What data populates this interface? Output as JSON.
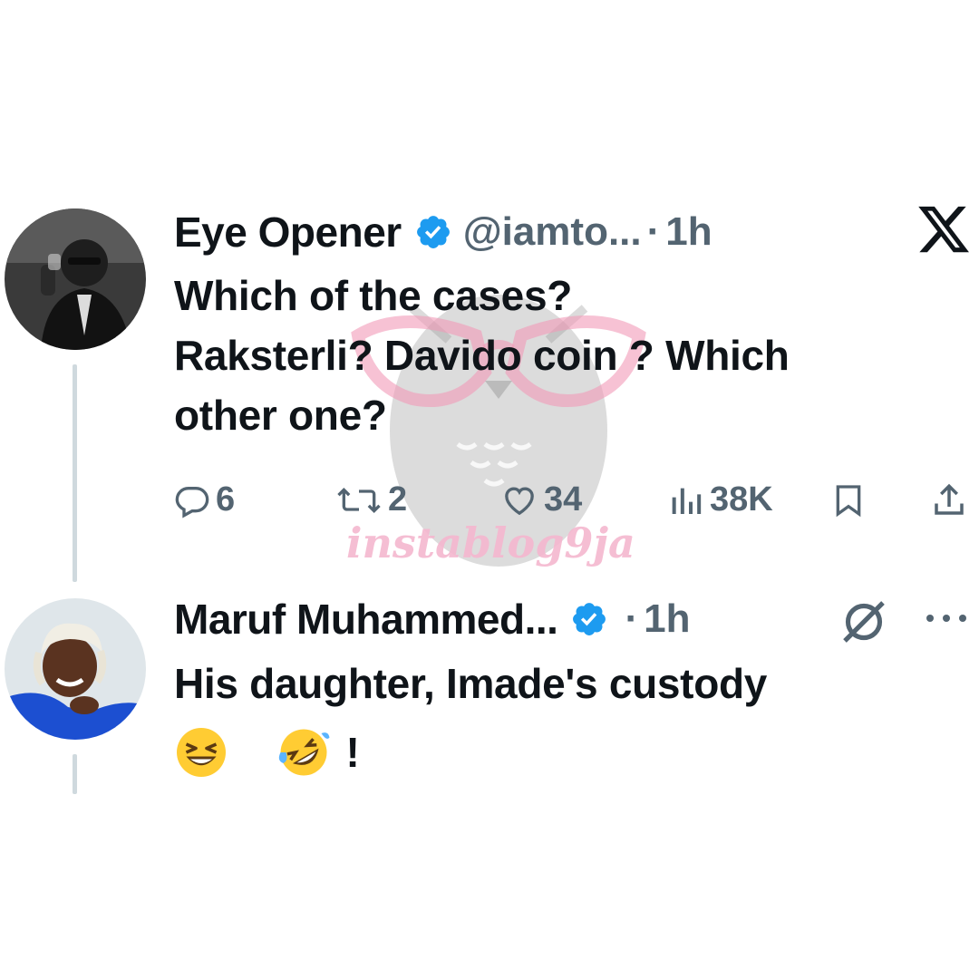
{
  "watermark": {
    "text": "instablog9ja"
  },
  "tweet1": {
    "author_name": "Eye Opener",
    "handle": "@iamto...",
    "separator": "·",
    "time": "1h",
    "text_lines": [
      "Which of the cases?",
      "Raksterli? Davido coin ? Which",
      "other one?"
    ],
    "replies": "6",
    "retweets": "2",
    "likes": "34",
    "views": "38K"
  },
  "tweet2": {
    "author_name": "Maruf Muhammed...",
    "separator": "·",
    "time": "1h",
    "text_line": "His daughter, Imade's custody",
    "emoji_suffix": "!"
  },
  "colors": {
    "verified": "#1d9bf0",
    "muted": "#536471",
    "thread_line": "#cfd9de",
    "watermark_pink": "#f5b7cf"
  },
  "icons": [
    "verified-badge-icon",
    "x-logo-icon",
    "reply-icon",
    "retweet-icon",
    "like-icon",
    "views-icon",
    "bookmark-icon",
    "share-icon",
    "grok-icon",
    "more-icon"
  ]
}
